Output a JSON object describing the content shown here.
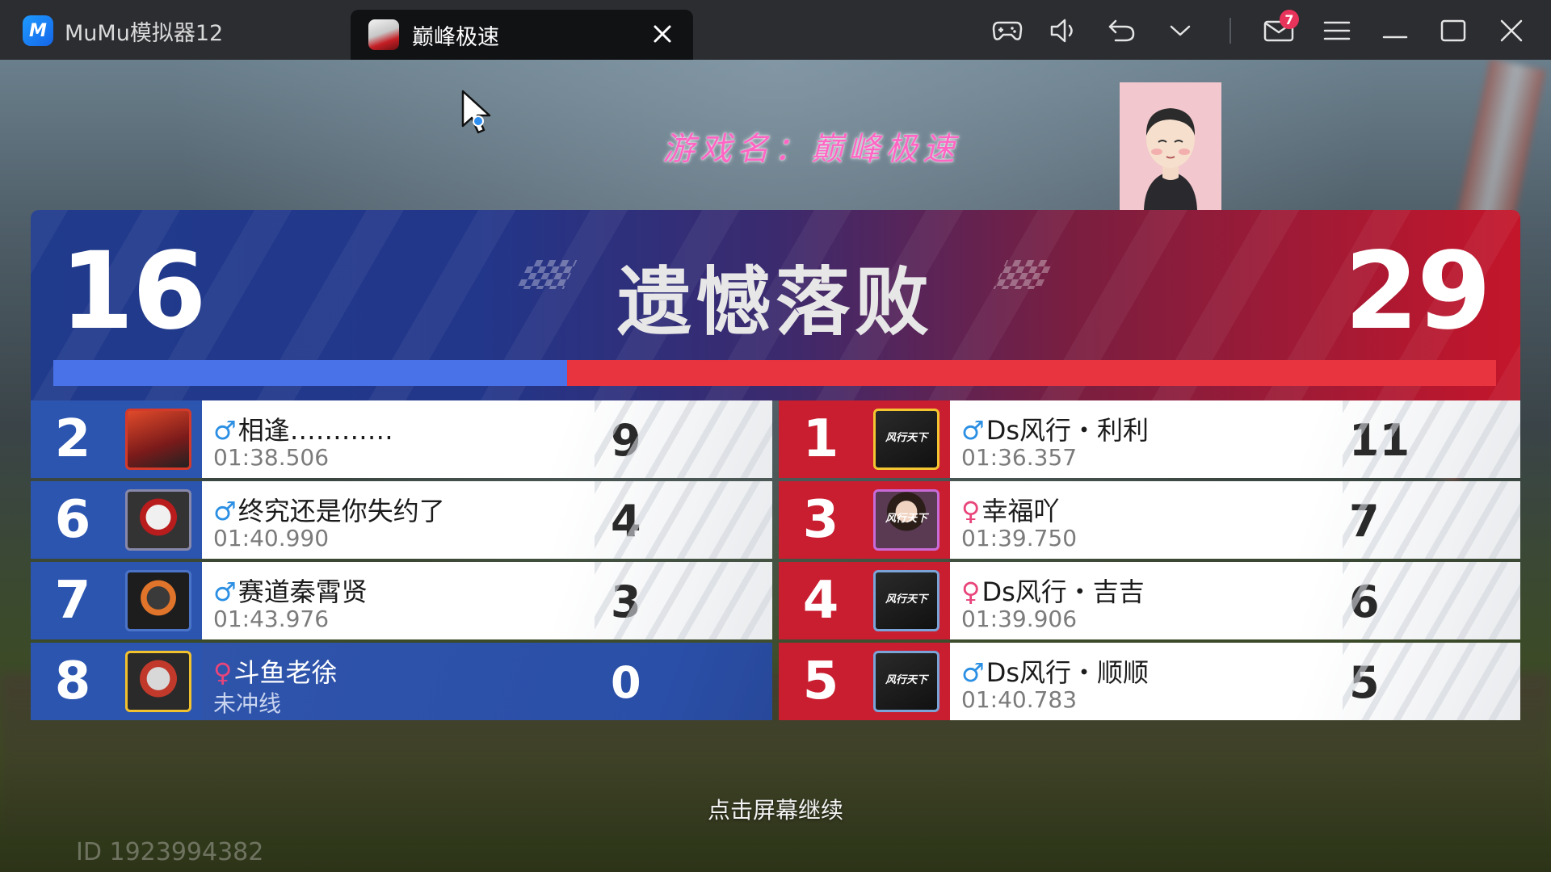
{
  "emulator": {
    "app_name": "MuMu模拟器12",
    "app_logo_text": "M",
    "active_tab": "巅峰极速",
    "mail_badge": "7",
    "icons": [
      "gamepad-icon",
      "volume-icon",
      "undo-icon",
      "chevron-down-icon",
      "mail-icon",
      "menu-icon",
      "minimize-icon",
      "maximize-icon",
      "close-icon"
    ]
  },
  "overlay": {
    "game_name": "游戏名：巅峰极速"
  },
  "result": {
    "title": "遗憾落败",
    "blue_score": "16",
    "red_score": "29",
    "blue_share": 0.356,
    "colors": {
      "blue": "#4a72e8",
      "red": "#e8343f"
    }
  },
  "blue_team": [
    {
      "rank": "2",
      "gender": "♂",
      "gender_type": "m",
      "name": "相逢…………",
      "time": "01:38.506",
      "points": "9"
    },
    {
      "rank": "6",
      "gender": "♂",
      "gender_type": "m",
      "name": "终究还是你失约了",
      "time": "01:40.990",
      "points": "4"
    },
    {
      "rank": "7",
      "gender": "♂",
      "gender_type": "m",
      "name": "赛道秦霄贤",
      "time": "01:43.976",
      "points": "3"
    },
    {
      "rank": "8",
      "gender": "♀",
      "gender_type": "f",
      "name": "斗鱼老徐",
      "time": "未冲线",
      "points": "0",
      "is_self": true
    }
  ],
  "red_team": [
    {
      "rank": "1",
      "gender": "♂",
      "gender_type": "m",
      "name": "Ds风行・利利",
      "time": "01:36.357",
      "points": "11"
    },
    {
      "rank": "3",
      "gender": "♀",
      "gender_type": "f",
      "name": "幸福吖",
      "time": "01:39.750",
      "points": "7"
    },
    {
      "rank": "4",
      "gender": "♀",
      "gender_type": "f",
      "name": "Ds风行・吉吉",
      "time": "01:39.906",
      "points": "6"
    },
    {
      "rank": "5",
      "gender": "♂",
      "gender_type": "m",
      "name": "Ds风行・顺顺",
      "time": "01:40.783",
      "points": "5"
    }
  ],
  "footer": {
    "continue_hint": "点击屏幕继续",
    "player_id": "ID 1923994382"
  }
}
